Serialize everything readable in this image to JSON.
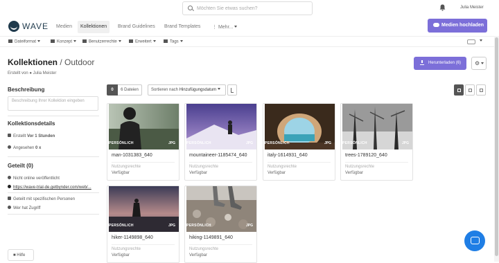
{
  "header": {
    "search_placeholder": "Möchten Sie etwas suchen?",
    "user_name": "Julia Meister",
    "logo_text": "WAVE"
  },
  "nav": {
    "items": [
      "Medien",
      "Kollektionen",
      "Brand Guidelines",
      "Brand Templates",
      "Mehr..."
    ],
    "active": "Kollektionen",
    "upload_label": "Medien hochladen"
  },
  "filters": [
    "Dateiformat",
    "Konzept",
    "Benutzerrechte",
    "Erweitert",
    "Tags"
  ],
  "page": {
    "title_main": "Kollektionen",
    "title_sep": " / ",
    "title_sub": "Outdoor",
    "created_prefix": "Erstellt von",
    "created_by": "Julia Meister",
    "download_label": "Herunterladen (6)"
  },
  "sidebar": {
    "description_heading": "Beschreibung",
    "description_placeholder": "Beschreibung Ihrer Kollektion eingeben",
    "details_heading": "Kollektionsdetails",
    "created_label": "Erstellt",
    "created_value": "Vor 1 Stunden",
    "views_label": "Angesehen",
    "views_value": "0 x",
    "shared_heading": "Geteilt (0)",
    "share_rows": [
      "Nicht online veröffentlicht",
      "https://wave-trial-de.getbynder.com/web/...",
      "Geteilt mit spezifischen Personen",
      "Wer hat Zugriff"
    ],
    "help_label": "Hilfe"
  },
  "toolbar": {
    "count": "0",
    "count_label": "6 Dateien",
    "sort_prefix": "Sortieren nach",
    "sort_value": "Hinzufügungsdatum"
  },
  "assets": [
    {
      "name": "man-1031383_640",
      "badge": "PERSÖNLICH",
      "format": "JPG",
      "rights_label": "Nutzungsrechte",
      "rights_value": "Verfügbar"
    },
    {
      "name": "mountaineer-1185474_640",
      "badge": "PERSÖNLICH",
      "format": "JPG",
      "rights_label": "Nutzungsrechte",
      "rights_value": "Verfügbar"
    },
    {
      "name": "italy-1614931_640",
      "badge": "PERSÖNLICH",
      "format": "JPG",
      "rights_label": "Nutzungsrechte",
      "rights_value": "Verfügbar"
    },
    {
      "name": "trees-1789120_640",
      "badge": "PERSÖNLICH",
      "format": "JPG",
      "rights_label": "Nutzungsrechte",
      "rights_value": "Verfügbar"
    },
    {
      "name": "hiker-1149898_640",
      "badge": "PERSÖNLICH",
      "format": "JPG",
      "rights_label": "Nutzungsrechte",
      "rights_value": "Verfügbar"
    },
    {
      "name": "hiking-1149891_640",
      "badge": "PERSÖNLICH",
      "format": "JPG",
      "rights_label": "Nutzungsrechte",
      "rights_value": "Verfügbar"
    }
  ],
  "colors": {
    "accent": "#7c6fd9",
    "logo": "#1f3a4c",
    "chat": "#1f7ee5"
  }
}
